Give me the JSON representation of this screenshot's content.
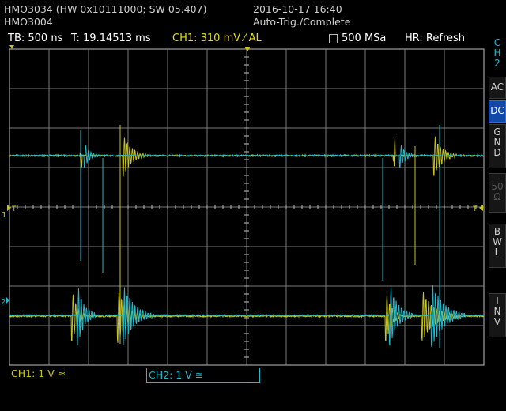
{
  "header": {
    "device_line": "HMO3034 (HW 0x10111000; SW 05.407)",
    "model": "HMO3004",
    "datetime": "2016-10-17 16:40",
    "trigger_status": "Auto-Trig./Complete"
  },
  "status_bar": {
    "timebase": "TB: 500 ns",
    "trigger_time": "T: 19.14513 ms",
    "ch1_trigger": "CH1: 310 mV ⁄ AL",
    "sample_rate": "500 MSa",
    "hr_mode": "HR: Refresh"
  },
  "sidebar": {
    "channel": [
      "C",
      "H",
      "2"
    ],
    "buttons": [
      {
        "lines": [
          "AC"
        ],
        "state": "normal"
      },
      {
        "lines": [
          "DC"
        ],
        "state": "active"
      },
      {
        "lines": [
          "G",
          "N",
          "D"
        ],
        "state": "normal"
      },
      {
        "lines": [
          "50",
          "Ω"
        ],
        "state": "disabled"
      },
      {
        "lines": [
          "B",
          "W",
          "L"
        ],
        "state": "normal"
      },
      {
        "lines": [
          "I",
          "N",
          "V"
        ],
        "state": "normal"
      }
    ]
  },
  "channels": {
    "ch1": {
      "label": "CH1: 1 V ≈",
      "color": "#c8c41e"
    },
    "ch2": {
      "label": "CH2: 1 V ≅",
      "color": "#23b8cc"
    }
  },
  "markers": {
    "ch1_ground": "1",
    "ch2_ground": "2",
    "trigger_level": "T"
  },
  "colors": {
    "grid": "#7a7a7a",
    "ch1": "#c8c41e",
    "ch2": "#23b8cc",
    "active_button": "#1248a8"
  }
}
